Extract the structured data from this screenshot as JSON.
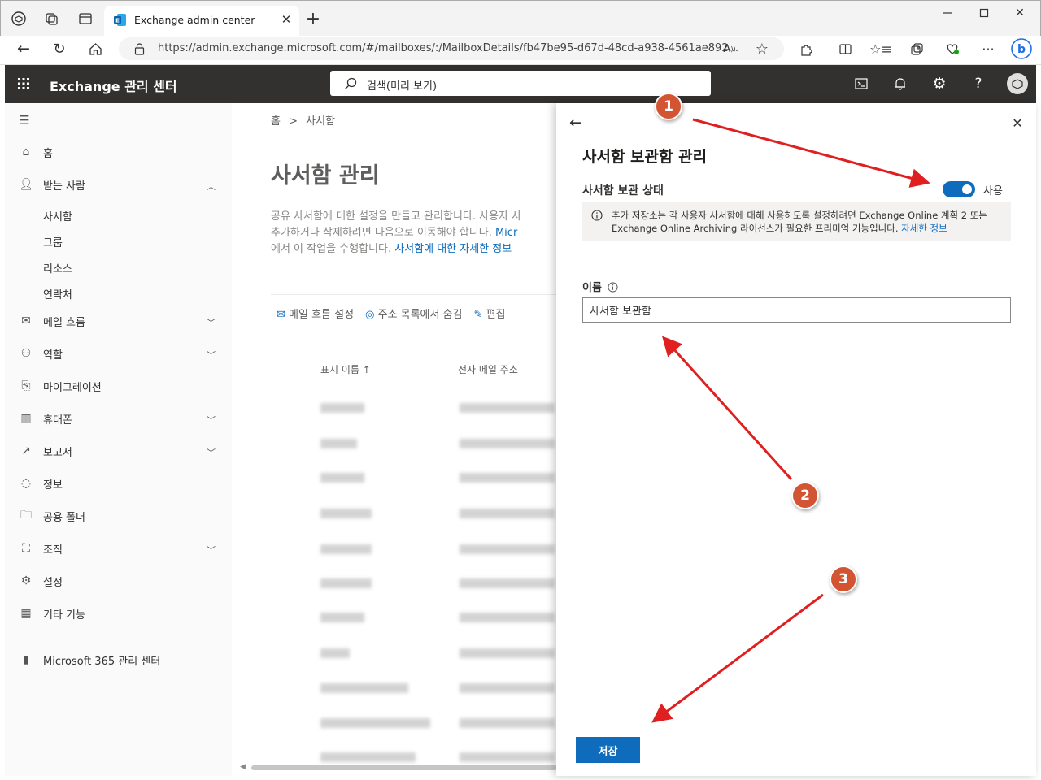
{
  "browser": {
    "tab_title": "Exchange admin center",
    "url": "https://admin.exchange.microsoft.com/#/mailboxes/:/MailboxDetails/fb47be95-d67d-48cd-a938-4561ae892..."
  },
  "app": {
    "title": "Exchange 관리 센터",
    "search_placeholder": "검색(미리 보기)"
  },
  "nav": {
    "home": "홈",
    "recipients": "받는 사람",
    "recipients_sub": [
      "사서함",
      "그룹",
      "리소스",
      "연락처"
    ],
    "mail_flow": "메일 흐름",
    "roles": "역할",
    "migration": "마이그레이션",
    "mobile": "휴대폰",
    "reports": "보고서",
    "insights": "정보",
    "public_folders": "공용 폴더",
    "organization": "조직",
    "settings": "설정",
    "other_features": "기타 기능",
    "m365": "Microsoft 365 관리 센터"
  },
  "main": {
    "breadcrumb_home": "홈",
    "breadcrumb_current": "사서함",
    "title": "사서함 관리",
    "desc_line1": "공유 사서함에 대한 설정을 만들고 관리합니다. 사용자 사",
    "desc_line2_a": "추가하거나 삭제하려면 다음으로 이동해야 합니다. ",
    "desc_line2_link": "Micr",
    "desc_line3_a": "에서 이 작업을 수행합니다. ",
    "desc_line3_link": "사서함에 대한 자세한 정보",
    "cmd_mailflow": "메일 흐름 설정",
    "cmd_hide": "주소 목록에서 숨김",
    "cmd_edit": "편집",
    "col_display": "표시 이름 ↑",
    "col_email": "전자 메일 주소"
  },
  "panel": {
    "title": "사서함 보관함 관리",
    "status_label": "사서함 보관 상태",
    "toggle_text": "사용",
    "info_text": "추가 저장소는 각 사용자 사서함에 대해 사용하도록 설정하려면 Exchange Online 계획 2 또는 Exchange Online Archiving 라이선스가 필요한 프리미엄 기능입니다. ",
    "info_link": "자세한 정보",
    "name_label": "이름",
    "name_value": "사서함 보관함",
    "save": "저장"
  },
  "badges": [
    "1",
    "2",
    "3"
  ],
  "colors": {
    "accent": "#0f6cbd",
    "appbar": "#323130",
    "badge": "#d35432",
    "arrow": "#e02020"
  }
}
